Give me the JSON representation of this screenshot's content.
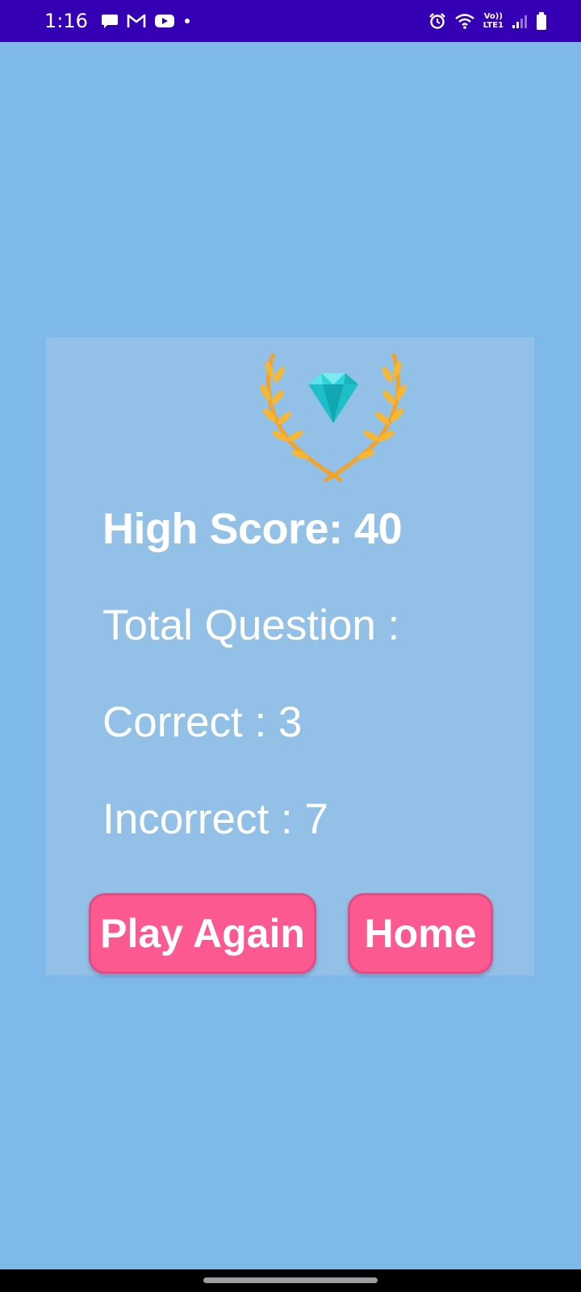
{
  "status_bar": {
    "time": "1:16",
    "network_label_top": "Vo))",
    "network_label_bottom": "LTE1",
    "background_color": "#3500B3",
    "icons": [
      "message-icon",
      "gmail-icon",
      "youtube-icon",
      "notification-dot-icon",
      "alarm-icon",
      "wifi-icon",
      "signal-icon",
      "battery-icon"
    ]
  },
  "result_card": {
    "high_score_label": "High Score: 40",
    "total_question_label": "Total Question :",
    "correct_label": "Correct : 3",
    "incorrect_label": "Incorrect : 7",
    "trophy_icon": "diamond-laurel-icon"
  },
  "buttons": {
    "play_again": "Play Again",
    "home": "Home"
  },
  "colors": {
    "background": "#7EB9EA",
    "card": "#93C0E7",
    "button": "#FB5990",
    "diamond": "#2ED3DC",
    "laurel": "#F3A326"
  }
}
